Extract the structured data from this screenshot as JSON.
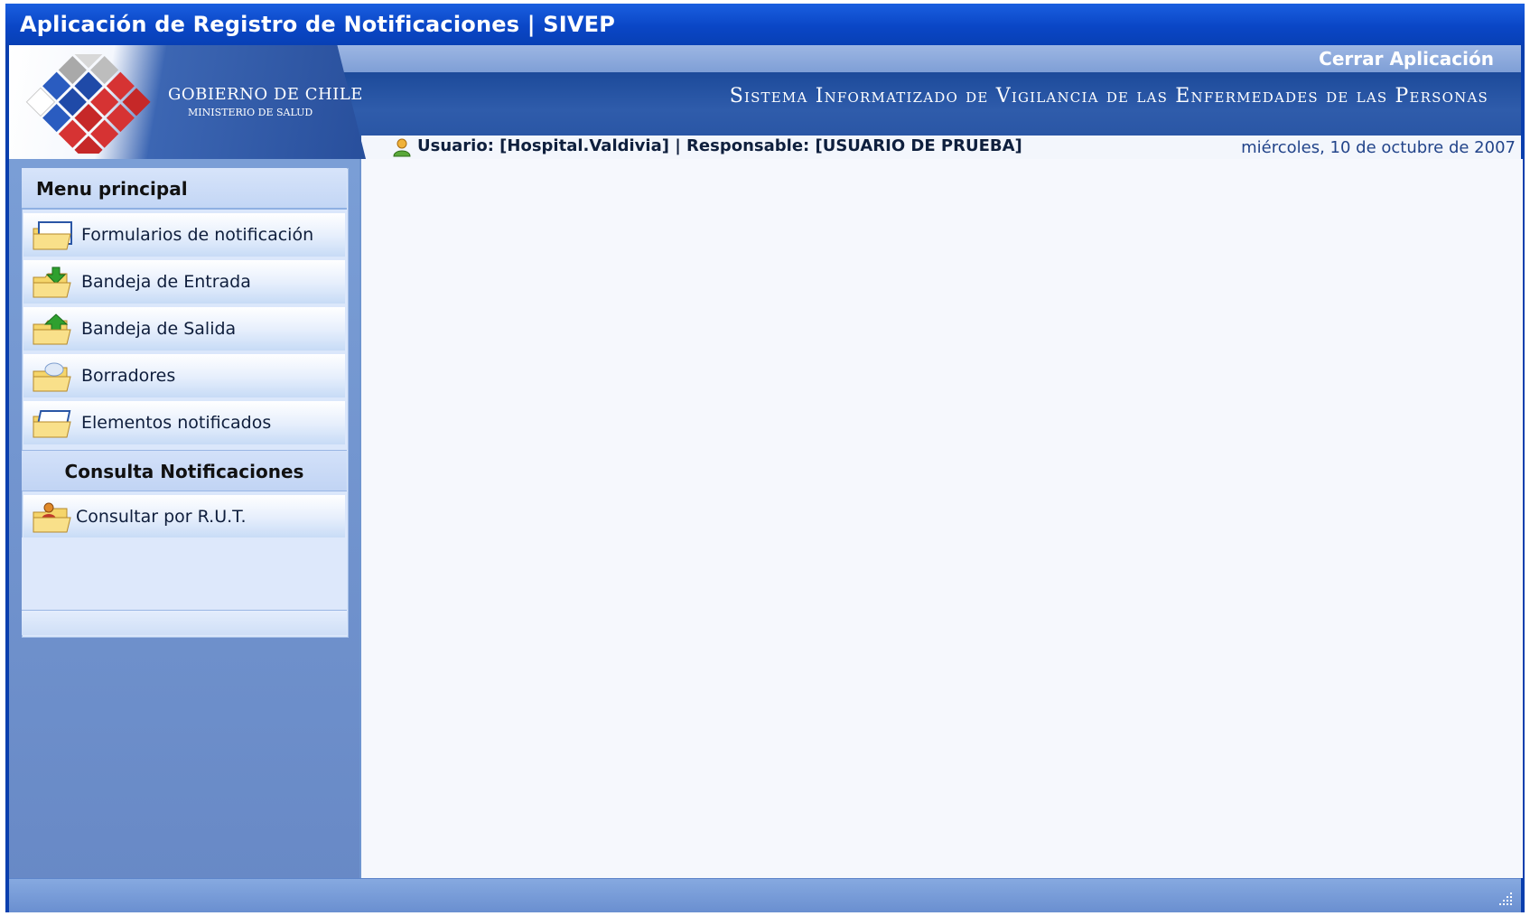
{
  "window": {
    "title": "Aplicación de Registro de Notificaciones | SIVEP"
  },
  "header": {
    "logo_title": "GOBIERNO DE CHILE",
    "logo_subtitle": "MINISTERIO DE SALUD",
    "close_label": "Cerrar Aplicación",
    "system_title": "Sistema Informatizado de Vigilancia de las Enfermedades de las Personas",
    "user_line": "Usuario: [Hospital.Valdivia] | Responsable: [USUARIO DE PRUEBA]",
    "date": "miércoles, 10 de octubre de 2007"
  },
  "menu": {
    "header": "Menu principal",
    "items": [
      {
        "label": "Formularios de notificación",
        "icon": "folder-form-icon"
      },
      {
        "label": "Bandeja de Entrada",
        "icon": "inbox-folder-icon"
      },
      {
        "label": "Bandeja de Salida",
        "icon": "outbox-folder-icon"
      },
      {
        "label": "Borradores",
        "icon": "drafts-folder-icon"
      },
      {
        "label": "Elementos notificados",
        "icon": "notified-folder-icon"
      }
    ],
    "section": "Consulta Notificaciones",
    "consult_item": {
      "label": "Consultar por R.U.T.",
      "icon": "user-search-folder-icon"
    }
  },
  "colors": {
    "titlebar": "#0a46c6",
    "header_blue": "#2a56a5",
    "menu_bg": "#dbe7fb",
    "content_bg": "#f6f8fd"
  }
}
